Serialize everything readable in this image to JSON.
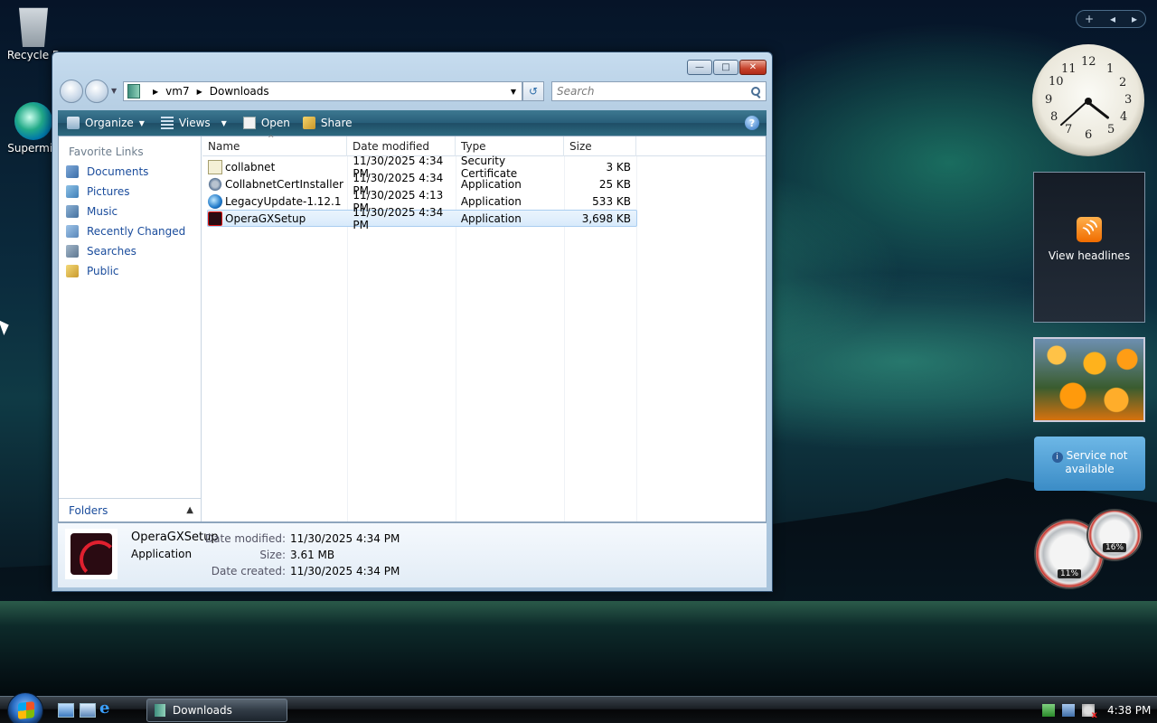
{
  "desktop": {
    "icons": [
      {
        "label": "Recycle B"
      },
      {
        "label": "Supermiu"
      }
    ]
  },
  "window": {
    "address": {
      "crumbs": [
        "vm7",
        "Downloads"
      ],
      "search_placeholder": "Search"
    },
    "toolbar": {
      "organize": "Organize",
      "views": "Views",
      "open": "Open",
      "share": "Share",
      "help": "?"
    },
    "nav": {
      "title": "Favorite Links",
      "items": [
        {
          "label": "Documents"
        },
        {
          "label": "Pictures"
        },
        {
          "label": "Music"
        },
        {
          "label": "Recently Changed"
        },
        {
          "label": "Searches"
        },
        {
          "label": "Public"
        }
      ],
      "folders_label": "Folders"
    },
    "columns": {
      "name": "Name",
      "date": "Date modified",
      "type": "Type",
      "size": "Size"
    },
    "files": [
      {
        "name": "collabnet",
        "date": "11/30/2025 4:34 PM",
        "type": "Security Certificate",
        "size": "3 KB",
        "icon": "certificate-icon"
      },
      {
        "name": "CollabnetCertInstaller",
        "date": "11/30/2025 4:34 PM",
        "type": "Application",
        "size": "25 KB",
        "icon": "installer-icon"
      },
      {
        "name": "LegacyUpdate-1.12.1",
        "date": "11/30/2025 4:13 PM",
        "type": "Application",
        "size": "533 KB",
        "icon": "globe-icon"
      },
      {
        "name": "OperaGXSetup",
        "date": "11/30/2025 4:34 PM",
        "type": "Application",
        "size": "3,698 KB",
        "icon": "opera-icon",
        "selected": true
      }
    ],
    "details": {
      "name": "OperaGXSetup",
      "type": "Application",
      "date_modified_label": "Date modified:",
      "date_modified": "11/30/2025 4:34 PM",
      "size_label": "Size:",
      "size": "3.61 MB",
      "date_created_label": "Date created:",
      "date_created": "11/30/2025 4:34 PM"
    }
  },
  "sidebar": {
    "add": "+",
    "prev": "◂",
    "next": "▸",
    "clock_numbers": [
      "12",
      "1",
      "2",
      "3",
      "4",
      "5",
      "6",
      "7",
      "8",
      "9",
      "10",
      "11"
    ],
    "feed_label": "View headlines",
    "weather_text": "Service not available",
    "cpu_pct": "11%",
    "mem_pct": "16%"
  },
  "taskbar": {
    "task_label": "Downloads",
    "time": "4:38 PM"
  }
}
